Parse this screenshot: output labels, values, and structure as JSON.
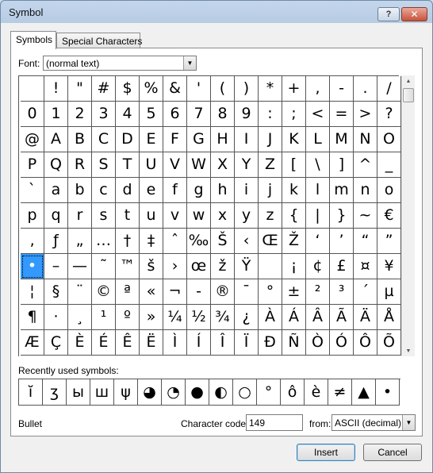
{
  "window": {
    "title": "Symbol",
    "help_label": "?",
    "close_label": "✕"
  },
  "tabs": [
    {
      "label": "Symbols"
    },
    {
      "label": "Special Characters"
    }
  ],
  "font": {
    "label": "Font:",
    "value": "(normal text)"
  },
  "symbol_rows": [
    [
      " ",
      "!",
      "\"",
      "#",
      "$",
      "%",
      "&",
      "'",
      "(",
      ")",
      "*",
      "+",
      ",",
      "-",
      ".",
      "/"
    ],
    [
      "0",
      "1",
      "2",
      "3",
      "4",
      "5",
      "6",
      "7",
      "8",
      "9",
      ":",
      ";",
      "<",
      "=",
      ">",
      "?"
    ],
    [
      "@",
      "A",
      "B",
      "C",
      "D",
      "E",
      "F",
      "G",
      "H",
      "I",
      "J",
      "K",
      "L",
      "M",
      "N",
      "O"
    ],
    [
      "P",
      "Q",
      "R",
      "S",
      "T",
      "U",
      "V",
      "W",
      "X",
      "Y",
      "Z",
      "[",
      "\\",
      "]",
      "^",
      "_"
    ],
    [
      "`",
      "a",
      "b",
      "c",
      "d",
      "e",
      "f",
      "g",
      "h",
      "i",
      "j",
      "k",
      "l",
      "m",
      "n",
      "o"
    ],
    [
      "p",
      "q",
      "r",
      "s",
      "t",
      "u",
      "v",
      "w",
      "x",
      "y",
      "z",
      "{",
      "|",
      "}",
      "~",
      "€"
    ],
    [
      "‚",
      "ƒ",
      "„",
      "…",
      "†",
      "‡",
      "ˆ",
      "‰",
      "Š",
      "‹",
      "Œ",
      "Ž",
      "‘",
      "’",
      "“",
      "”"
    ],
    [
      "•",
      "–",
      "—",
      "˜",
      "™",
      "š",
      "›",
      "œ",
      "ž",
      "Ÿ",
      " ",
      "¡",
      "¢",
      "£",
      "¤",
      "¥"
    ],
    [
      "¦",
      "§",
      "¨",
      "©",
      "ª",
      "«",
      "¬",
      "-",
      "®",
      "¯",
      "°",
      "±",
      "²",
      "³",
      "´",
      "µ"
    ],
    [
      "¶",
      "·",
      "¸",
      "¹",
      "º",
      "»",
      "¼",
      "½",
      "¾",
      "¿",
      "À",
      "Á",
      "Â",
      "Ã",
      "Ä",
      "Å"
    ],
    [
      "Æ",
      "Ç",
      "È",
      "É",
      "Ê",
      "Ë",
      "Ì",
      "Í",
      "Î",
      "Ï",
      "Ð",
      "Ñ",
      "Ò",
      "Ó",
      "Ô",
      "Õ"
    ]
  ],
  "selected": {
    "row": 7,
    "col": 0
  },
  "recent": {
    "label": "Recently used symbols:",
    "symbols": [
      "ĭ",
      "ʒ",
      "ы",
      "ш",
      "ψ",
      "◕",
      "◔",
      "●",
      "◐",
      "○",
      "°",
      "ô",
      "è",
      "≠",
      "▲",
      "•"
    ]
  },
  "description": "Bullet",
  "character_code": {
    "label": "Character code:",
    "value": "149"
  },
  "from": {
    "label": "from:",
    "value": "ASCII (decimal)"
  },
  "buttons": {
    "insert": "Insert",
    "cancel": "Cancel"
  }
}
